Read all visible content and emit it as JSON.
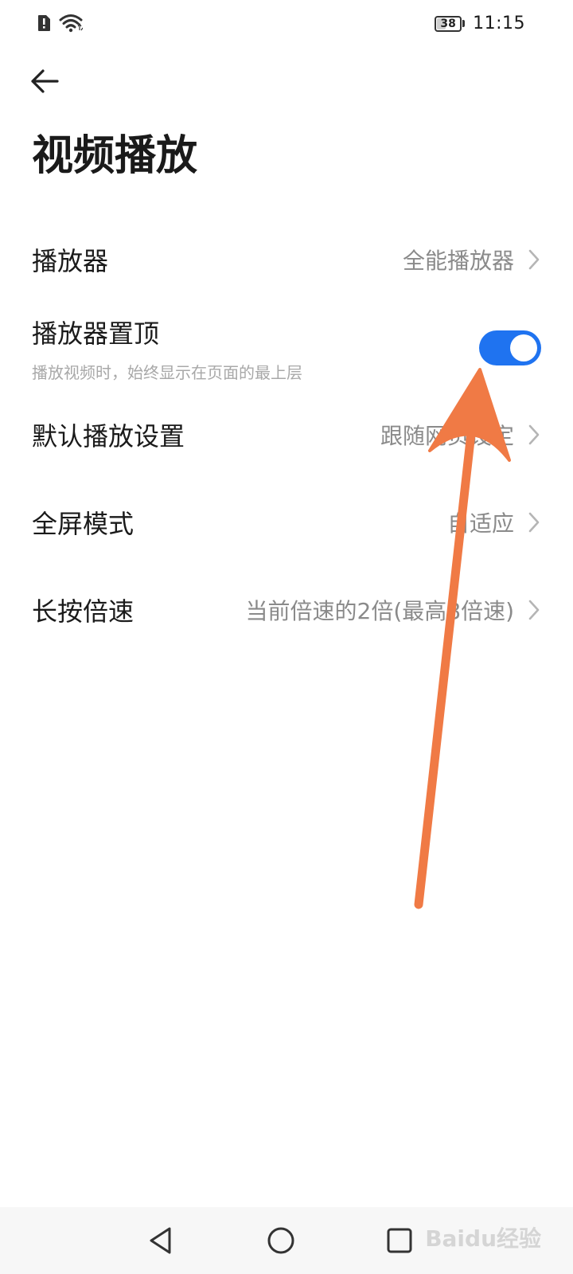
{
  "status_bar": {
    "time": "11:15",
    "battery": "38",
    "icons": [
      "alert-sim-icon",
      "wifi-icon"
    ]
  },
  "header": {
    "title": "视频播放"
  },
  "settings": [
    {
      "label": "播放器",
      "value": "全能播放器",
      "type": "link"
    },
    {
      "label": "播放器置顶",
      "subtitle": "播放视频时，始终显示在页面的最上层",
      "type": "toggle",
      "on": true
    },
    {
      "label": "默认播放设置",
      "value": "跟随网页设定",
      "type": "link"
    },
    {
      "label": "全屏模式",
      "value": "自适应",
      "type": "link"
    },
    {
      "label": "长按倍速",
      "value": "当前倍速的2倍(最高8倍速)",
      "type": "link"
    }
  ],
  "colors": {
    "toggle_on": "#1f73f0",
    "annotation_arrow": "#f07a45"
  },
  "watermark": "Baidu经验"
}
